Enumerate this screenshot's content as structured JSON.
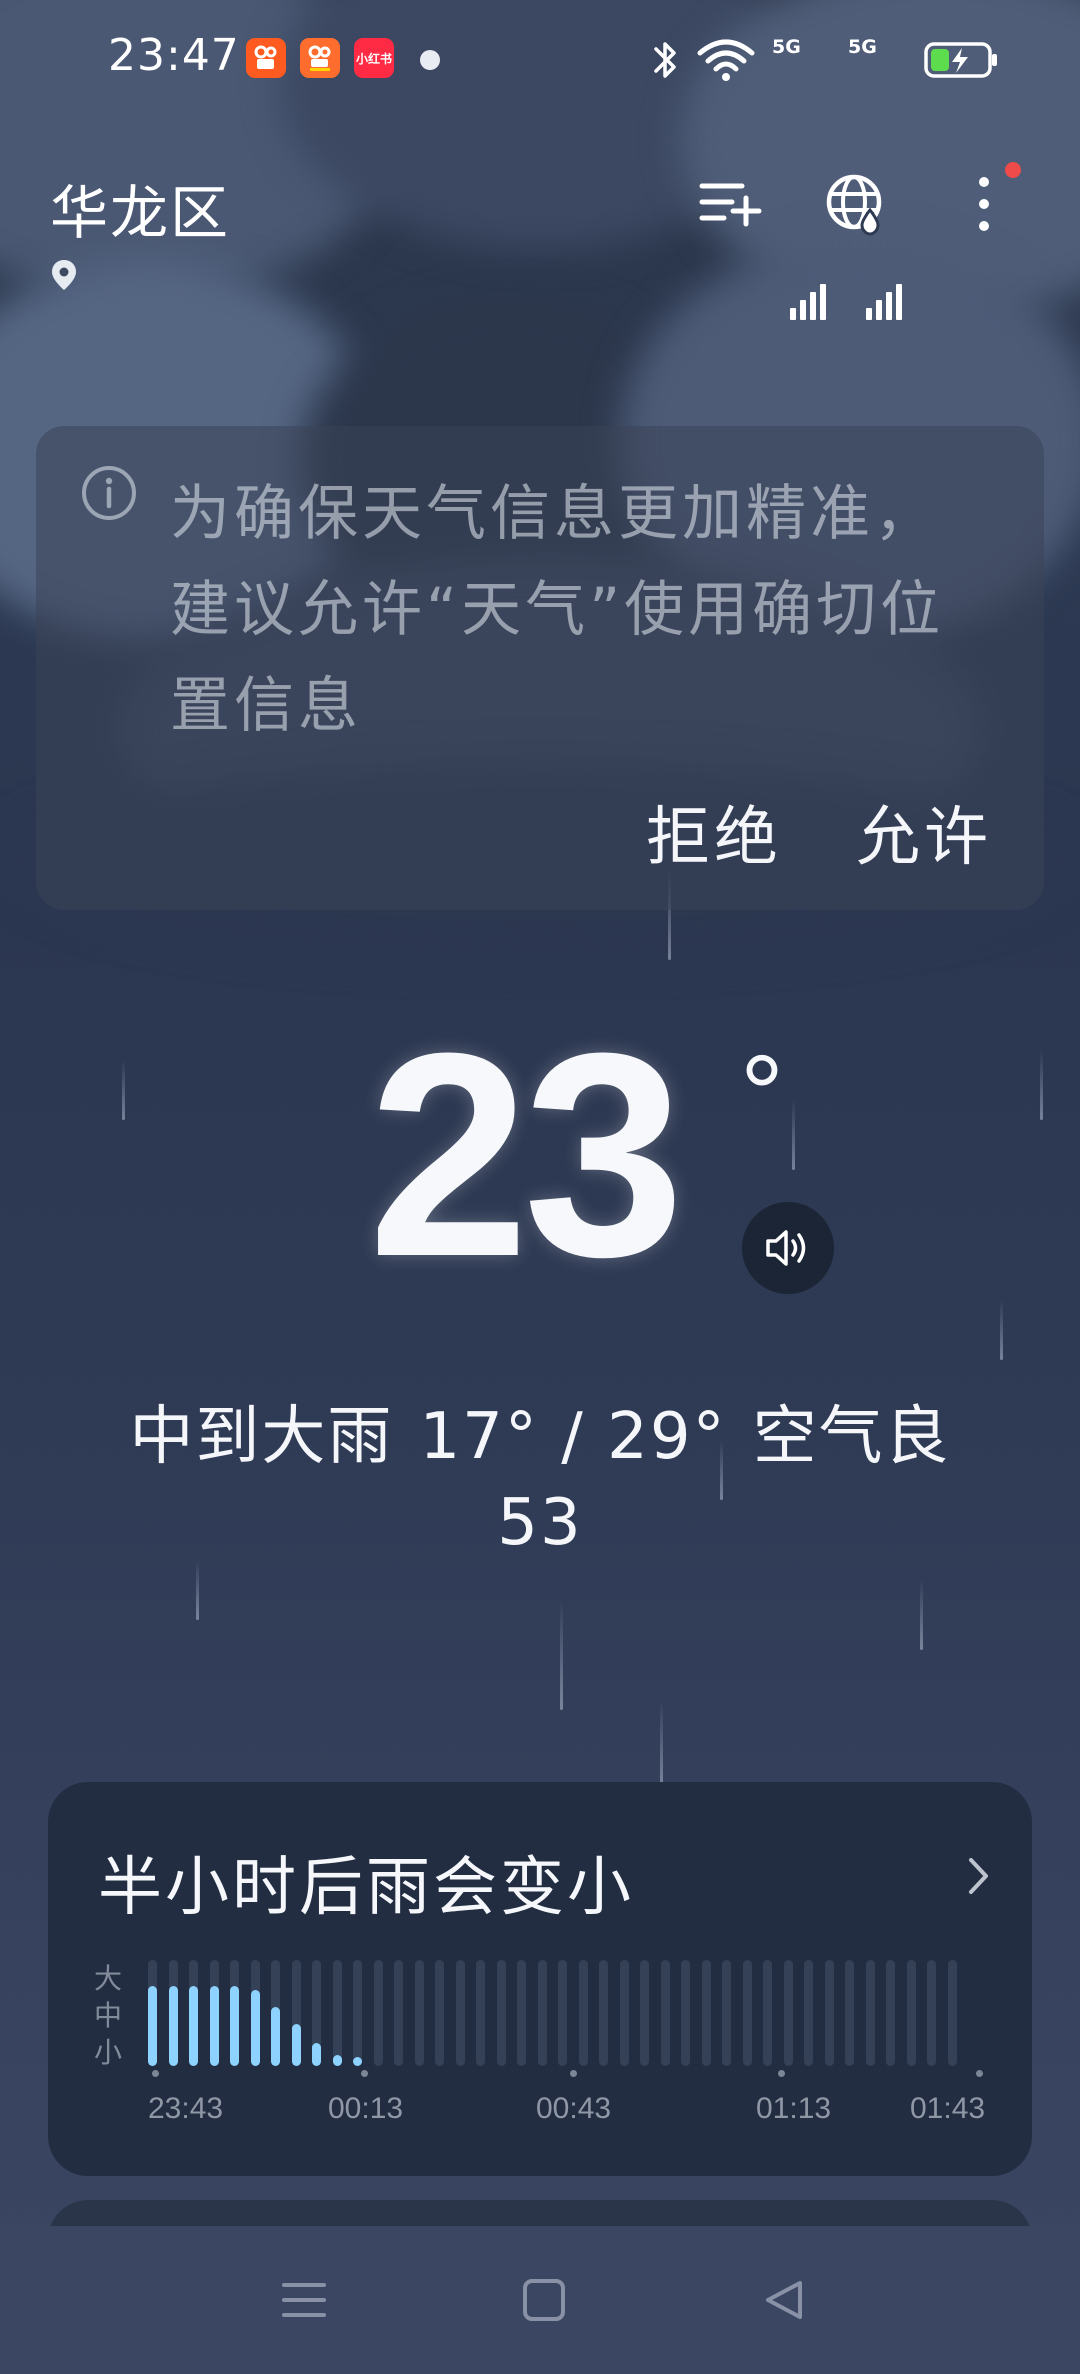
{
  "status_bar": {
    "time": "23:47",
    "notification_apps": [
      {
        "name": "kuaishou-icon",
        "color": "#ff5a1f"
      },
      {
        "name": "kuaishou-speed-icon",
        "color": "#ff6d2e"
      },
      {
        "name": "xiaohongshu-icon",
        "label": "小红书",
        "color": "#ff2a44"
      }
    ],
    "signal_1_label": "5G",
    "signal_2_label": "5G",
    "battery_state": "charging"
  },
  "header": {
    "location": "华龙区",
    "icons": [
      "add-city-icon",
      "globe-rain-icon",
      "more-options-icon"
    ]
  },
  "permission_prompt": {
    "message": "为确保天气信息更加精准，建议允许“天气”使用确切位置信息",
    "deny_label": "拒绝",
    "allow_label": "允许"
  },
  "current": {
    "temperature": "23",
    "degree_symbol": "°",
    "condition": "中到大雨",
    "range": "17° / 29°",
    "air_quality_label": "空气良",
    "air_quality_value": "53"
  },
  "rain_forecast": {
    "title": "半小时后雨会变小",
    "intensity_labels": [
      "大",
      "中",
      "小"
    ],
    "time_labels": [
      "23:43",
      "00:13",
      "00:43",
      "01:13",
      "01:43"
    ],
    "intensity_series": [
      0.75,
      0.75,
      0.75,
      0.75,
      0.75,
      0.72,
      0.56,
      0.4,
      0.22,
      0.1,
      0.08,
      0,
      0,
      0,
      0,
      0,
      0,
      0,
      0,
      0,
      0,
      0,
      0,
      0,
      0,
      0,
      0,
      0,
      0,
      0,
      0,
      0,
      0,
      0,
      0,
      0,
      0,
      0,
      0,
      0
    ],
    "accent_color": "#8ed3ff"
  },
  "nav_bar": {
    "buttons": [
      "menu-icon",
      "home-icon",
      "back-icon"
    ]
  }
}
